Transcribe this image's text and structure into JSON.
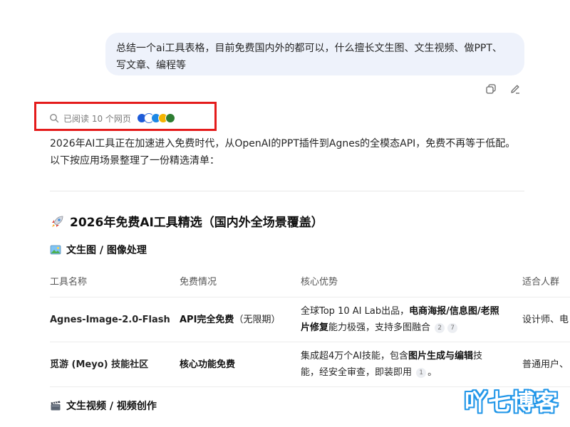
{
  "user_message": {
    "line1": "总结一个ai工具表格，目前免费国内外的都可以，什么擅长文生图、文生视频、做PPT、",
    "line2": "写文章、编程等"
  },
  "message_actions": {
    "copy_icon": "copy-icon",
    "edit_icon": "edit-icon"
  },
  "sources": {
    "label": "已阅读 10 个网页",
    "icon": "search-icon"
  },
  "answer": {
    "intro_line1": "2026年AI工具正在加速进入免费时代，从OpenAI的PPT插件到Agnes的全模态API，免费不再等于低配。",
    "intro_line2": "以下按应用场景整理了一份精选清单：",
    "title": "2026年免费AI工具精选（国内外全场景覆盖）",
    "title_emoji": "rocket",
    "sections": {
      "image": {
        "title": "文生图 / 图像处理",
        "emoji": "picture"
      },
      "video": {
        "title": "文生视频 / 视频创作",
        "emoji": "clapper"
      }
    },
    "table": {
      "headers": [
        "工具名称",
        "免费情况",
        "核心优势",
        "适合人群"
      ],
      "rows": [
        {
          "name": "Agnes-Image-2.0-Flash",
          "free_bold": "API完全免费",
          "free_rest": "（无限期）",
          "adv_1": "全球Top 10 AI Lab出品，",
          "adv_bold": "电商海报/信息图/老照",
          "adv_bold2": "片修复",
          "adv_2": "能力极强，支持多图融合",
          "cites": [
            "2",
            "7"
          ],
          "audience": "设计师、电"
        },
        {
          "name": "觅游 (Meyo) 技能社区",
          "free_bold": "核心功能免费",
          "free_rest": "",
          "adv_1": "集成超4万个AI技能，包含",
          "adv_bold": "图片生成与编辑",
          "adv_2": "技",
          "adv_3": "能，经安全审查，即装即用",
          "cites": [
            "1"
          ],
          "audience": "普通用户、"
        }
      ]
    }
  },
  "watermark": "吖七博客",
  "colors": {
    "bubble": "#eef2fb",
    "highlight": "#e41b1b",
    "watermark": "#2196e8"
  }
}
